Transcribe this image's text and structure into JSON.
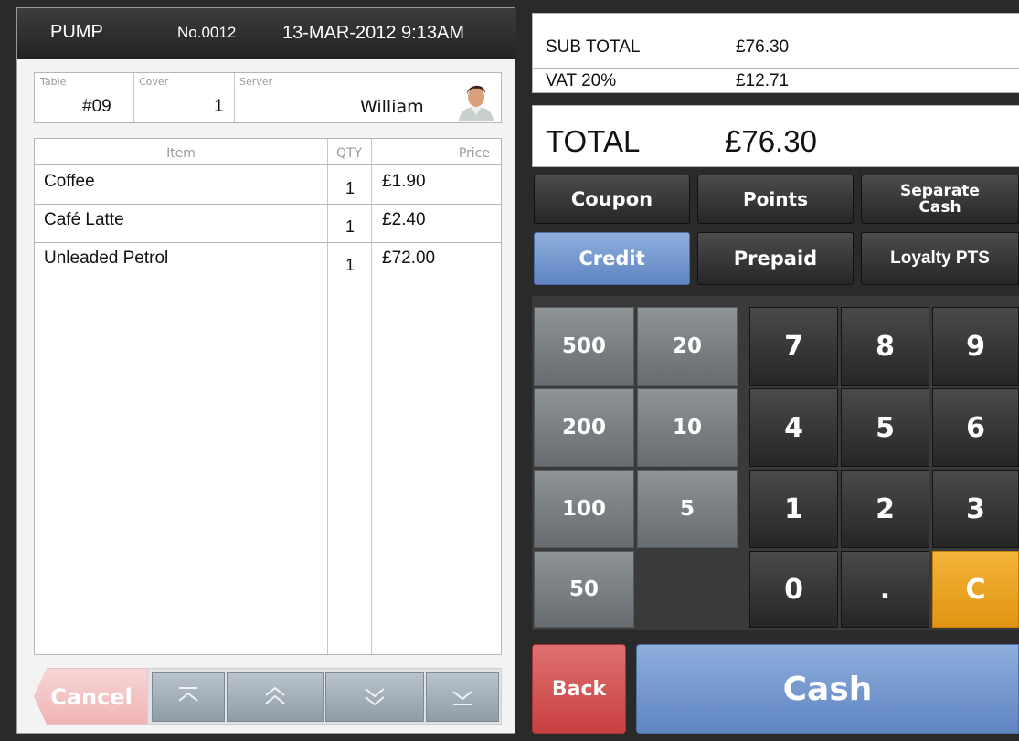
{
  "ticket_header": {
    "title": "PUMP",
    "number": "No.0012",
    "datetime": "13-MAR-2012 9:13AM"
  },
  "info": {
    "table_caption": "Table",
    "table_value": "#09",
    "cover_caption": "Cover",
    "cover_value": "1",
    "server_caption": "Server",
    "server_value": "William",
    "avatar_icon": "person-avatar-icon"
  },
  "items": {
    "headers": {
      "item": "Item",
      "qty": "QTY",
      "price": "Price"
    },
    "rows": [
      {
        "name": "Coffee",
        "qty": "1",
        "price": "£1.90"
      },
      {
        "name": "Café Latte",
        "qty": "1",
        "price": "£2.40"
      },
      {
        "name": "Unleaded Petrol",
        "qty": "1",
        "price": "£72.00"
      }
    ]
  },
  "controls": {
    "cancel_label": "Cancel",
    "nav_icons": [
      "scroll-top-icon",
      "scroll-up-icon",
      "scroll-down-icon",
      "scroll-bottom-icon"
    ]
  },
  "summary": {
    "subtotal_label": "SUB TOTAL",
    "subtotal_value": "£76.30",
    "vat_label": "VAT 20%",
    "vat_value": "£12.71",
    "total_label": "TOTAL",
    "total_value": "£76.30"
  },
  "payment_methods": {
    "coupon": "Coupon",
    "points": "Points",
    "separate_cash_line1": "Separate",
    "separate_cash_line2": "Cash",
    "credit": "Credit",
    "prepaid": "Prepaid",
    "loyalty": "Loyalty PTS"
  },
  "keypad": {
    "quick_amounts": [
      "500",
      "20",
      "200",
      "10",
      "100",
      "5",
      "50"
    ],
    "digits": [
      "7",
      "8",
      "9",
      "4",
      "5",
      "6",
      "1",
      "2",
      "3",
      "0",
      "."
    ],
    "clear": "C"
  },
  "actions": {
    "back": "Back",
    "cash": "Cash"
  },
  "colors": {
    "accent_blue": "#6f92cf",
    "clear_orange": "#eca428",
    "back_red": "#d45858"
  }
}
